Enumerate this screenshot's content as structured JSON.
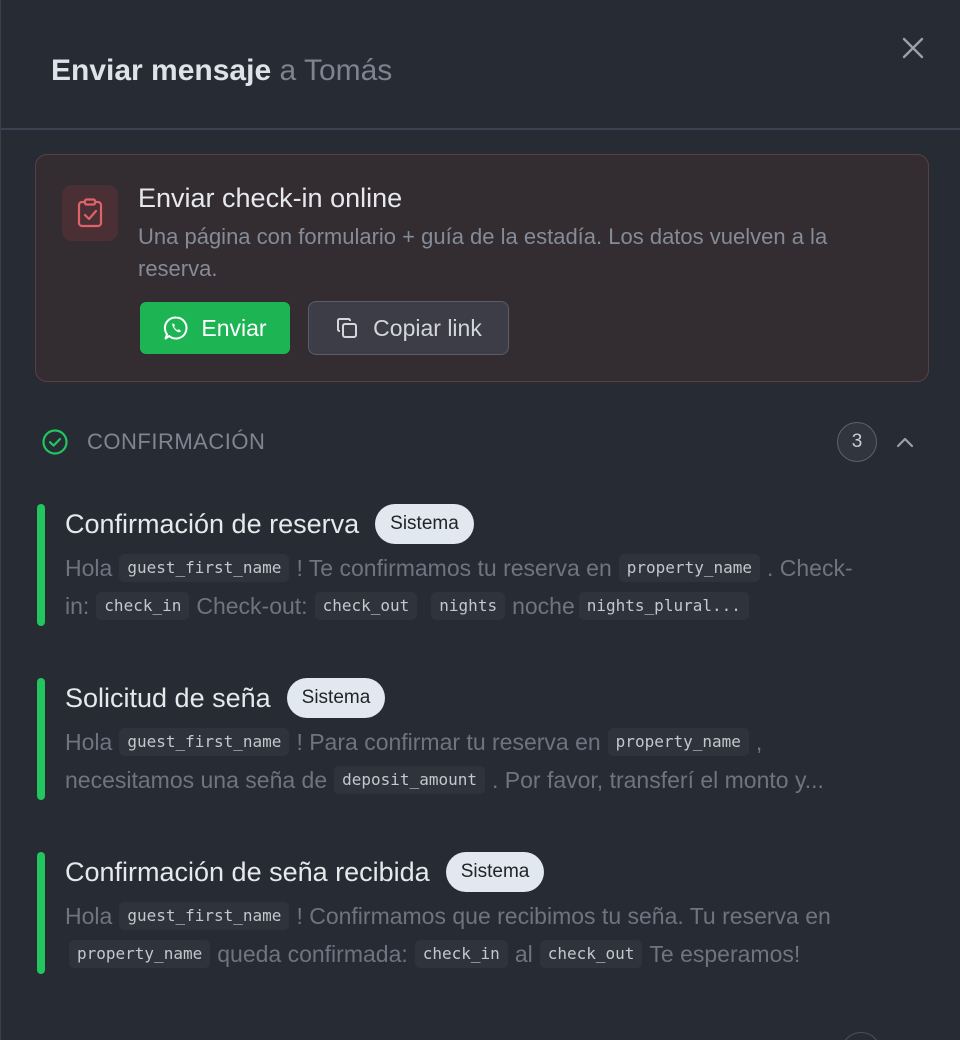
{
  "header": {
    "title": "Enviar mensaje",
    "recipient": "a Tomás"
  },
  "checkin_card": {
    "icon": "clipboard-check-icon",
    "title": "Enviar check-in online",
    "description": "Una página con formulario + guía de la estadía. Los datos vuelven a la reserva.",
    "send_label": "Enviar",
    "copy_label": "Copiar link",
    "accent": "#1db454"
  },
  "section": {
    "label": "CONFIRMACIÓN",
    "count": "3"
  },
  "templates": [
    {
      "name": "Confirmación de reserva",
      "badge": "Sistema",
      "line1": {
        "t0": "Hola",
        "v0": "guest_first_name",
        "t1": "! Te confirmamos tu reserva en",
        "v1": "property_name",
        "t2": ". Check-"
      },
      "line2": {
        "t0": "in:",
        "v0": "check_in",
        "t1": "Check-out:",
        "v1": "check_out",
        "v2": "nights",
        "t2": "noche",
        "v3": "nights_plural..."
      }
    },
    {
      "name": "Solicitud de seña",
      "badge": "Sistema",
      "line1": {
        "t0": "Hola",
        "v0": "guest_first_name",
        "t1": "! Para confirmar tu reserva en",
        "v1": "property_name",
        "t2": ","
      },
      "line2": {
        "t0": "necesitamos una seña de",
        "v0": "deposit_amount",
        "t1": ". Por favor, transferí el monto y..."
      }
    },
    {
      "name": "Confirmación de seña recibida",
      "badge": "Sistema",
      "line1": {
        "t0": "Hola",
        "v0": "guest_first_name",
        "t1": "! Confirmamos que recibimos tu seña. Tu reserva en"
      },
      "line2": {
        "v0": "property_name",
        "t0": "queda confirmada:",
        "v1": "check_in",
        "t1": "al",
        "v2": "check_out",
        "t2": "Te esperamos!"
      }
    }
  ]
}
